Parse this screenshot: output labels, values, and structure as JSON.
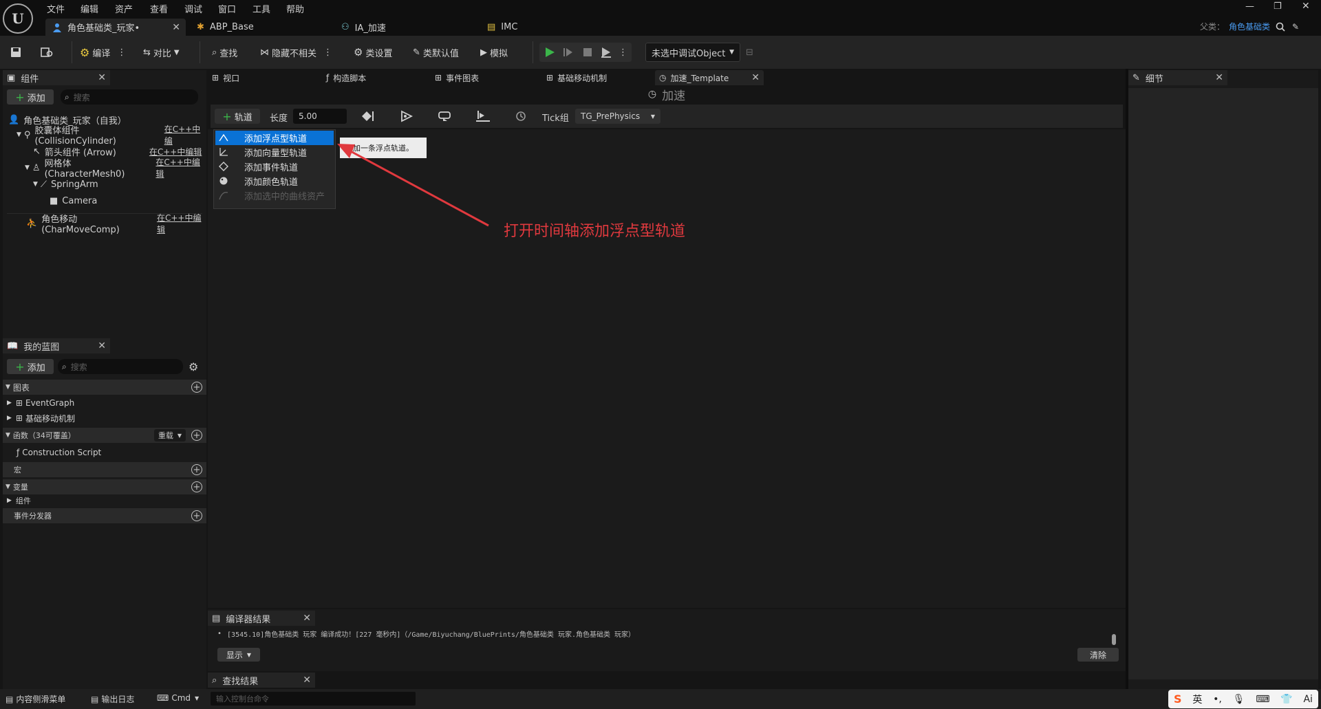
{
  "menu": [
    "文件",
    "编辑",
    "资产",
    "查看",
    "调试",
    "窗口",
    "工具",
    "帮助"
  ],
  "tabs": [
    {
      "label": "角色基础类_玩家•",
      "icon": "person-icon"
    },
    {
      "label": "ABP_Base",
      "icon": "animation-icon"
    },
    {
      "label": "IA_加速",
      "icon": "input-action-icon"
    },
    {
      "label": "IMC",
      "icon": "mapping-context-icon"
    }
  ],
  "parent": {
    "label": "父类：",
    "value": "角色基础类"
  },
  "toolbar": {
    "compile": "编译",
    "diff": "对比",
    "find": "查找",
    "hide_unrelated": "隐藏不相关",
    "class_settings": "类设置",
    "class_defaults": "类默认值",
    "simulate": "模拟",
    "debug_object": "未选中调试Object"
  },
  "components": {
    "title": "组件",
    "add": "添加",
    "search_placeholder": "搜索",
    "root": "角色基础类_玩家（自我）",
    "items": [
      {
        "label": "胶囊体组件 (CollisionCylinder)",
        "link": "在C++中编"
      },
      {
        "label": "箭头组件 (Arrow)",
        "link": "在C++中编辑"
      },
      {
        "label": "网格体 (CharacterMesh0)",
        "link": "在C++中编辑"
      },
      {
        "label": "SpringArm",
        "link": ""
      },
      {
        "label": "Camera",
        "link": ""
      },
      {
        "label": "角色移动 (CharMoveComp)",
        "link": "在C++中编辑"
      }
    ]
  },
  "blueprint": {
    "title": "我的蓝图",
    "add": "添加",
    "search_placeholder": "搜索",
    "graphs": "图表",
    "event_graph": "EventGraph",
    "base_move": "基础移动机制",
    "functions": "函数（34可覆盖）",
    "override": "重载",
    "construction": "Construction Script",
    "macros": "宏",
    "variables": "变量",
    "var_components": "组件",
    "dispatchers": "事件分发器"
  },
  "doc_tabs": [
    "视口",
    "构造脚本",
    "事件图表",
    "基础移动机制",
    "加速_Template"
  ],
  "timeline": {
    "name": "加速",
    "track_btn": "轨道",
    "length_label": "长度",
    "length": "5.00",
    "tick_label": "Tick组",
    "tick_value": "TG_PrePhysics"
  },
  "dropdown": {
    "items": [
      "添加浮点型轨道",
      "添加向量型轨道",
      "添加事件轨道",
      "添加颜色轨道",
      "添加选中的曲线资产"
    ],
    "tooltip": "添加一条浮点轨道。"
  },
  "annotation": "打开时间轴添加浮点型轨道",
  "details": {
    "title": "细节"
  },
  "compiler": {
    "title": "编译器结果",
    "log": "[3545.10]角色基础类_玩家 编译成功！[227 毫秒内]（/Game/Biyuchang/BluePrints/角色基础类_玩家.角色基础类_玩家）",
    "show": "显示",
    "clear": "清除"
  },
  "find_results": {
    "title": "查找结果"
  },
  "statusbar": {
    "content_drawer": "内容侧滑菜单",
    "output_log": "输出日志",
    "cmd": "Cmd",
    "console_placeholder": "输入控制台命令"
  },
  "ime": {
    "lang": "英",
    "ai": "Ai"
  },
  "colors": {
    "accent": "#0a72d6",
    "annotation": "#e0393e",
    "play": "#3bb54a"
  }
}
